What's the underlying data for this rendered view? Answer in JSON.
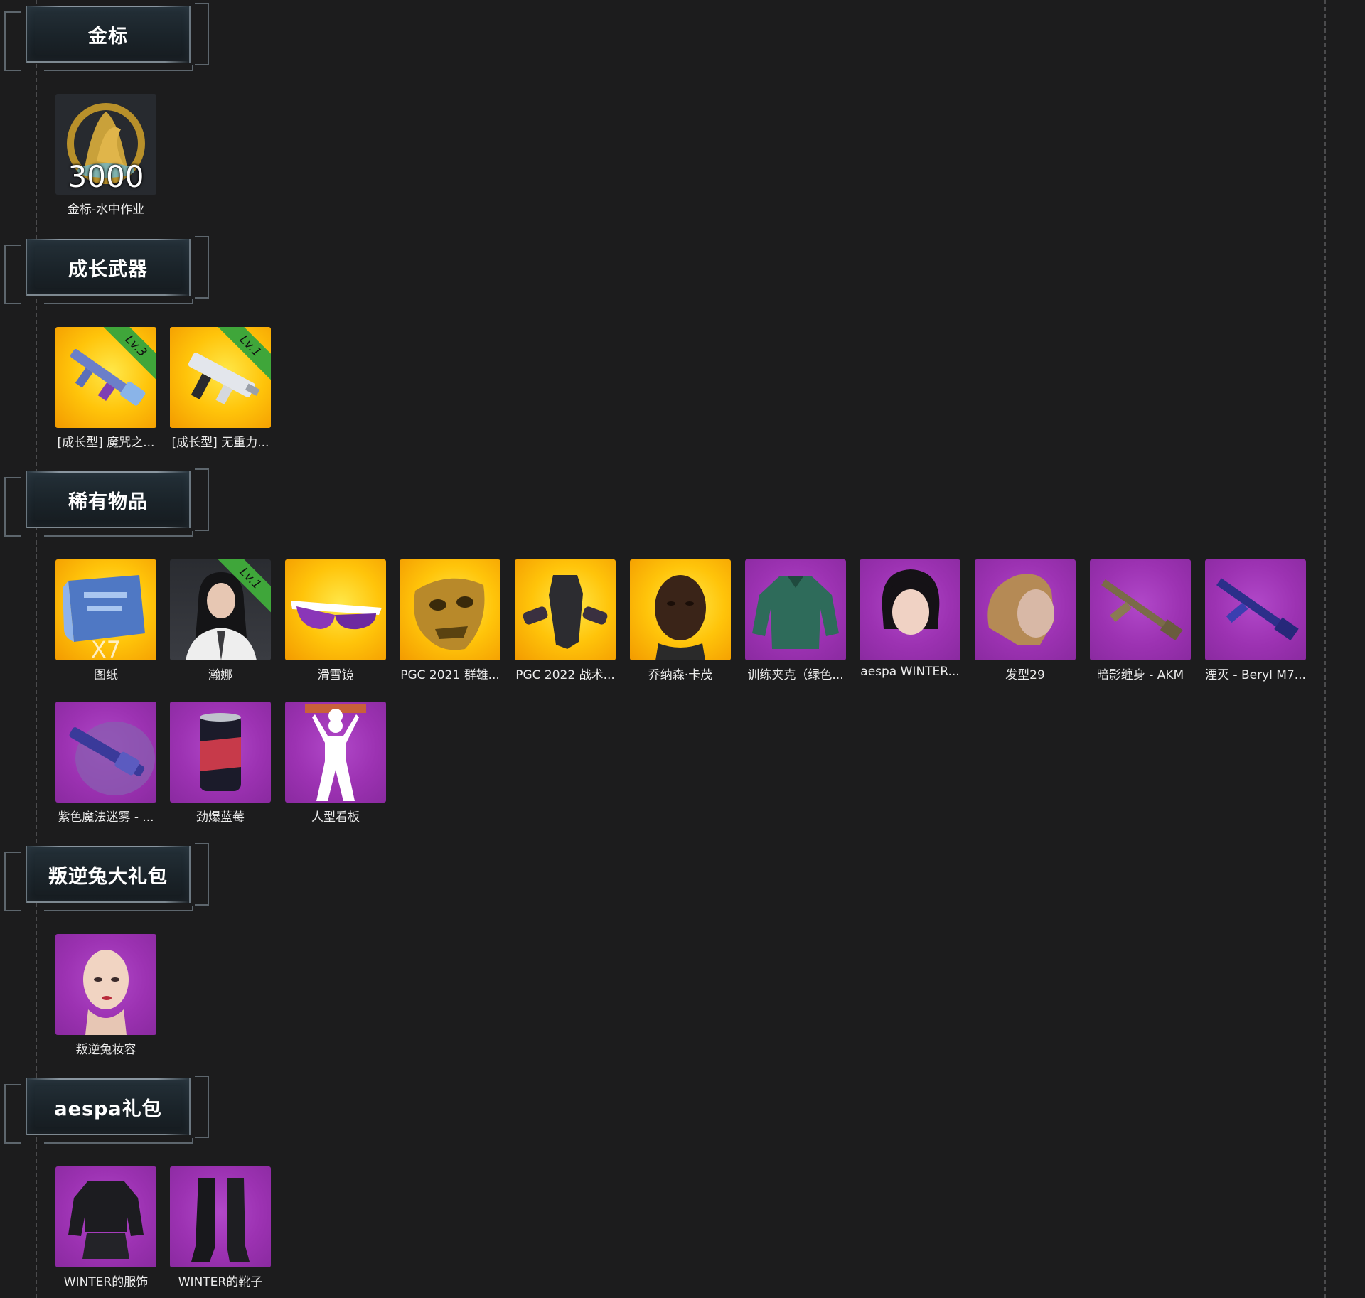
{
  "sections": [
    {
      "title": "金标",
      "items": [
        {
          "label": "金标-水中作业",
          "tile": "dark",
          "badge": "3000",
          "icon": "gold-seal-medal-icon"
        }
      ]
    },
    {
      "title": "成长武器",
      "items": [
        {
          "label": "[成长型] 魔咒之...",
          "tile": "gold",
          "level": "Lv.3",
          "icon": "assault-rifle-icon"
        },
        {
          "label": "[成长型] 无重力...",
          "tile": "gold",
          "level": "Lv.1",
          "icon": "smg-icon"
        }
      ]
    },
    {
      "title": "稀有物品",
      "items": [
        {
          "label": "图纸",
          "tile": "gold",
          "quantity": "X7",
          "icon": "blueprint-icon"
        },
        {
          "label": "瀚娜",
          "tile": "photo",
          "level": "Lv.1",
          "icon": "character-portrait-icon"
        },
        {
          "label": "滑雪镜",
          "tile": "gold",
          "icon": "ski-goggles-icon"
        },
        {
          "label": "PGC 2021 群雄...",
          "tile": "gold",
          "icon": "gold-mask-icon"
        },
        {
          "label": "PGC 2022 战术...",
          "tile": "gold",
          "icon": "tactical-vest-icon"
        },
        {
          "label": "乔纳森·卡茂",
          "tile": "gold",
          "icon": "male-face-icon"
        },
        {
          "label": "训练夹克（绿色...",
          "tile": "purple",
          "icon": "jacket-icon"
        },
        {
          "label": "aespa WINTER...",
          "tile": "purple",
          "icon": "female-face-icon"
        },
        {
          "label": "发型29",
          "tile": "purple",
          "icon": "hairstyle-icon"
        },
        {
          "label": "暗影缠身 - AKM",
          "tile": "purple",
          "icon": "akm-rifle-icon"
        },
        {
          "label": "湮灭 - Beryl M7...",
          "tile": "purple",
          "icon": "beryl-rifle-icon"
        },
        {
          "label": "紫色魔法迷雾 - ...",
          "tile": "purple",
          "icon": "shotgun-smoke-icon"
        },
        {
          "label": "劲爆蓝莓",
          "tile": "purple",
          "icon": "soda-can-icon"
        },
        {
          "label": "人型看板",
          "tile": "purple",
          "icon": "human-signboard-icon"
        }
      ]
    },
    {
      "title": "叛逆兔大礼包",
      "items": [
        {
          "label": "叛逆兔妆容",
          "tile": "purple",
          "icon": "makeup-face-icon"
        }
      ]
    },
    {
      "title": "aespa礼包",
      "items": [
        {
          "label": "WINTER的服饰",
          "tile": "purple",
          "icon": "leather-outfit-icon"
        },
        {
          "label": "WINTER的靴子",
          "tile": "purple",
          "icon": "boots-icon"
        }
      ]
    }
  ]
}
